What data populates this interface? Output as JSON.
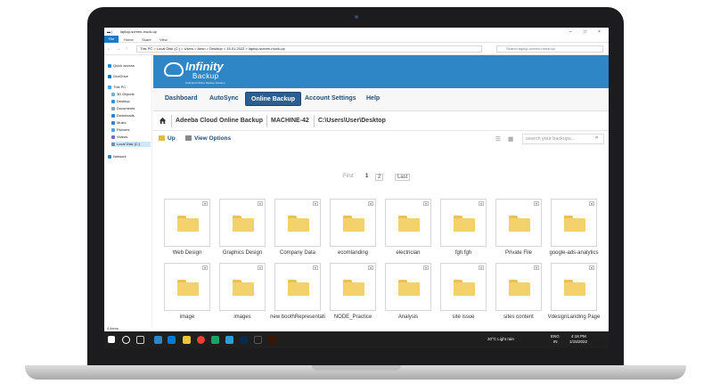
{
  "explorer": {
    "title": "laptop-screen-mock-up",
    "ribbon_tabs": [
      "File",
      "Home",
      "Share",
      "View"
    ],
    "address": "This PC  >  Local Disk (C:)  >  Users  >  Aesn  >  Desktop  >  15.01.2022  >  laptop-screen-mock-up",
    "search_placeholder": "Search laptop-screen-mock-up",
    "nav_items": [
      "Quick access",
      "OneDrive",
      "This PC",
      "3D Objects",
      "Desktop",
      "Documents",
      "Downloads",
      "Music",
      "Pictures",
      "Videos",
      "Local Disk (C:)",
      "Network"
    ],
    "status": "4 items"
  },
  "taskbar": {
    "weather": "20°C  Light rain",
    "lang": "ENG",
    "region": "IN",
    "time": "4:18 PM",
    "date": "1/15/2022"
  },
  "app": {
    "brand": {
      "name": "Infinity",
      "sub": "Backup",
      "tagline": "Unlimited Online Backup Solution"
    },
    "menu": [
      "Dashboard",
      "AutoSync",
      "Online Backup",
      "Account Settings",
      "Help"
    ],
    "active_menu": "Online Backup",
    "breadcrumb": [
      "Adeeba Cloud Online Backup",
      "MACHINE-42",
      "C:\\Users\\User\\Desktop"
    ],
    "toolbar": {
      "up": "Up",
      "view_options": "View Options",
      "search_placeholder": "search your backups..."
    },
    "pager": {
      "first": "First",
      "pages": [
        "1",
        "2"
      ],
      "current": "1",
      "last": "Last"
    },
    "files_row1": [
      "Web Design",
      "Graphics Design",
      "Company Data",
      "ecomlanding",
      "electrician",
      "fgh fgh",
      "Private File",
      "google-ads-analytics"
    ],
    "files_row2": [
      "image",
      "images",
      "new boothRepresentati",
      "NODE_Practice",
      "Analysis",
      "site issue",
      "sites content",
      "VdesignLanding Page"
    ]
  },
  "colors": {
    "brand_blue": "#2f86c6",
    "active_tab": "#2b5f93",
    "folder": "#f3d26b",
    "taskbar": "#1f1f1f"
  }
}
